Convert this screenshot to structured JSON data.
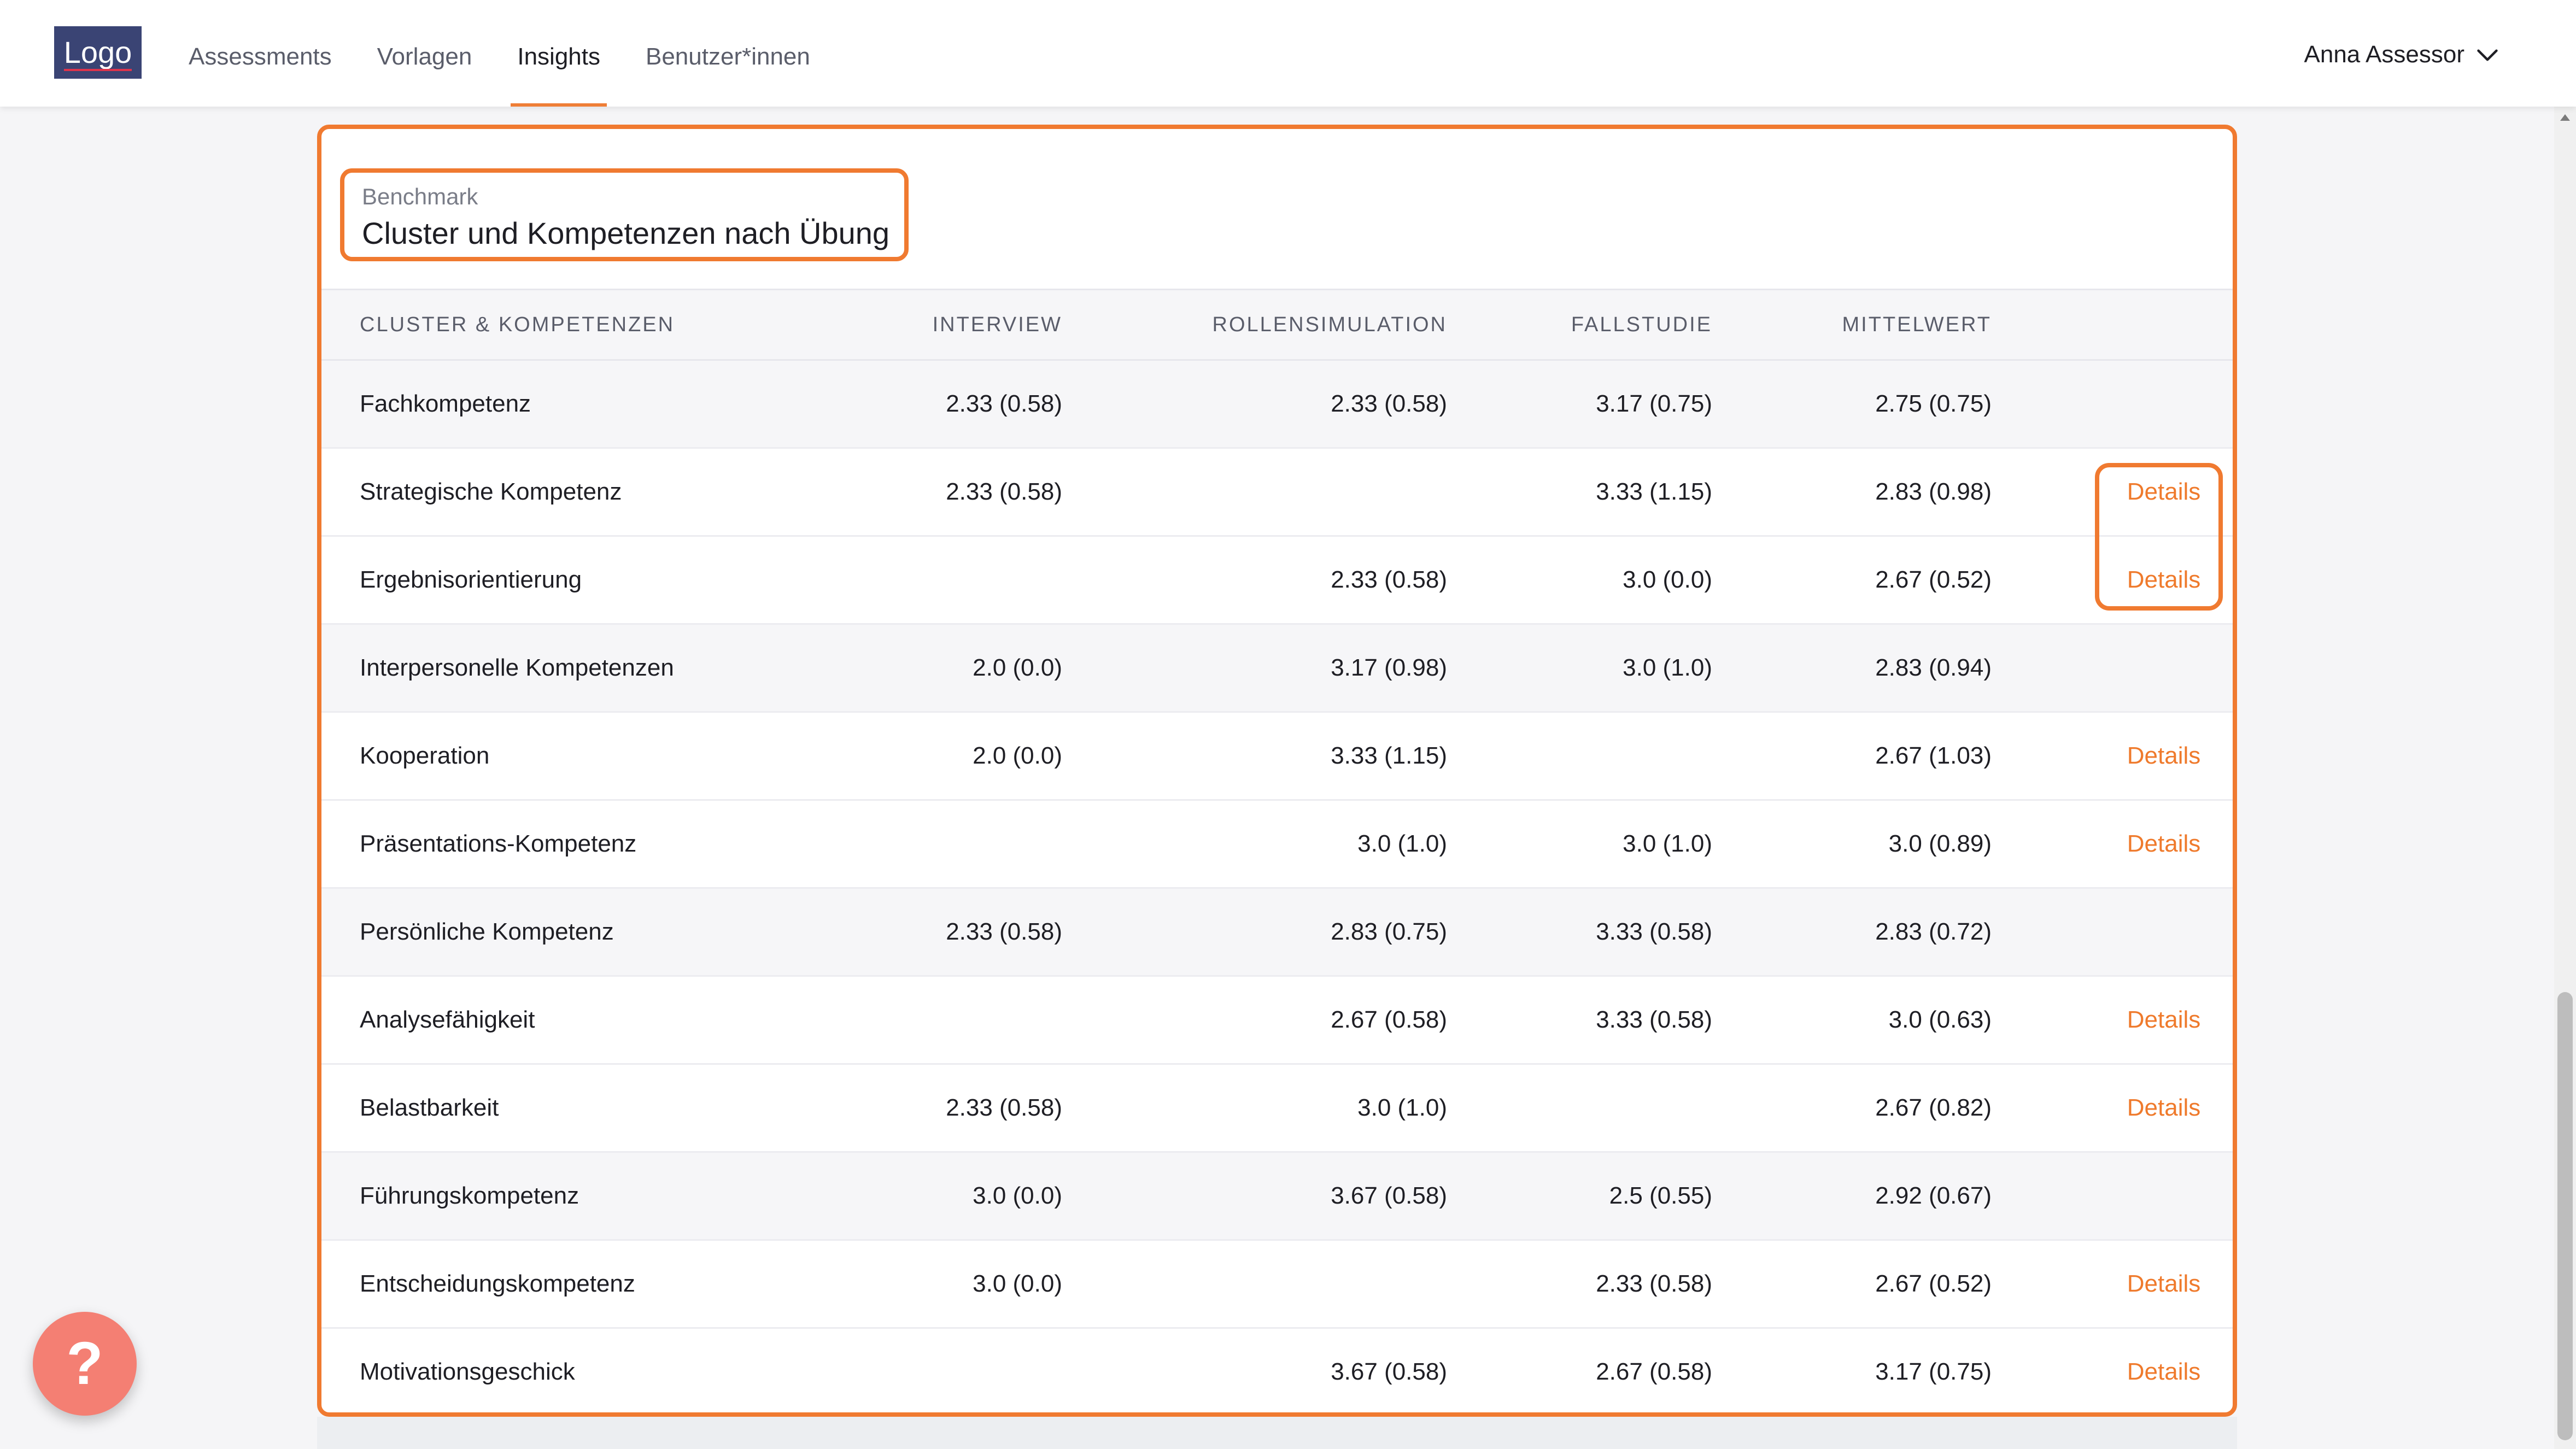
{
  "header": {
    "logo_text": "Logo",
    "nav": [
      {
        "label": "Assessments",
        "active": false
      },
      {
        "label": "Vorlagen",
        "active": false
      },
      {
        "label": "Insights",
        "active": true
      },
      {
        "label": "Benutzer*innen",
        "active": false
      }
    ],
    "user_name": "Anna Assessor",
    "user_icon": "chevron-down-icon"
  },
  "card": {
    "eyebrow": "Benchmark",
    "title": "Cluster und Kompetenzen nach Übung",
    "columns": [
      "CLUSTER & KOMPETENZEN",
      "INTERVIEW",
      "ROLLENSIMULATION",
      "FALLSTUDIE",
      "MITTELWERT"
    ],
    "rows": [
      {
        "name": "Fachkompetenz",
        "interview": "2.33 (0.58)",
        "rollensimulation": "2.33 (0.58)",
        "fallstudie": "3.17 (0.75)",
        "mittelwert": "2.75 (0.75)",
        "details": "",
        "cluster": true
      },
      {
        "name": "Strategische Kompetenz",
        "interview": "2.33 (0.58)",
        "rollensimulation": "",
        "fallstudie": "3.33 (1.15)",
        "mittelwert": "2.83 (0.98)",
        "details": "Details",
        "cluster": false
      },
      {
        "name": "Ergebnisorientierung",
        "interview": "",
        "rollensimulation": "2.33 (0.58)",
        "fallstudie": "3.0 (0.0)",
        "mittelwert": "2.67 (0.52)",
        "details": "Details",
        "cluster": false
      },
      {
        "name": "Interpersonelle Kompetenzen",
        "interview": "2.0 (0.0)",
        "rollensimulation": "3.17 (0.98)",
        "fallstudie": "3.0 (1.0)",
        "mittelwert": "2.83 (0.94)",
        "details": "",
        "cluster": true
      },
      {
        "name": "Kooperation",
        "interview": "2.0 (0.0)",
        "rollensimulation": "3.33 (1.15)",
        "fallstudie": "",
        "mittelwert": "2.67 (1.03)",
        "details": "Details",
        "cluster": false
      },
      {
        "name": "Präsentations-Kompetenz",
        "interview": "",
        "rollensimulation": "3.0 (1.0)",
        "fallstudie": "3.0 (1.0)",
        "mittelwert": "3.0 (0.89)",
        "details": "Details",
        "cluster": false
      },
      {
        "name": "Persönliche Kompetenz",
        "interview": "2.33 (0.58)",
        "rollensimulation": "2.83 (0.75)",
        "fallstudie": "3.33 (0.58)",
        "mittelwert": "2.83 (0.72)",
        "details": "",
        "cluster": true
      },
      {
        "name": "Analysefähigkeit",
        "interview": "",
        "rollensimulation": "2.67 (0.58)",
        "fallstudie": "3.33 (0.58)",
        "mittelwert": "3.0 (0.63)",
        "details": "Details",
        "cluster": false
      },
      {
        "name": "Belastbarkeit",
        "interview": "2.33 (0.58)",
        "rollensimulation": "3.0 (1.0)",
        "fallstudie": "",
        "mittelwert": "2.67 (0.82)",
        "details": "Details",
        "cluster": false
      },
      {
        "name": "Führungskompetenz",
        "interview": "3.0 (0.0)",
        "rollensimulation": "3.67 (0.58)",
        "fallstudie": "2.5 (0.55)",
        "mittelwert": "2.92 (0.67)",
        "details": "",
        "cluster": true
      },
      {
        "name": "Entscheidungskompetenz",
        "interview": "3.0 (0.0)",
        "rollensimulation": "",
        "fallstudie": "2.33 (0.58)",
        "mittelwert": "2.67 (0.52)",
        "details": "Details",
        "cluster": false
      },
      {
        "name": "Motivationsgeschick",
        "interview": "",
        "rollensimulation": "3.67 (0.58)",
        "fallstudie": "2.67 (0.58)",
        "mittelwert": "3.17 (0.75)",
        "details": "Details",
        "cluster": false
      }
    ]
  },
  "help": {
    "label": "?",
    "icon": "help-icon"
  },
  "colors": {
    "accent": "#f07a30",
    "logo_bg": "#3a4474",
    "help_bg": "#f47f73"
  }
}
